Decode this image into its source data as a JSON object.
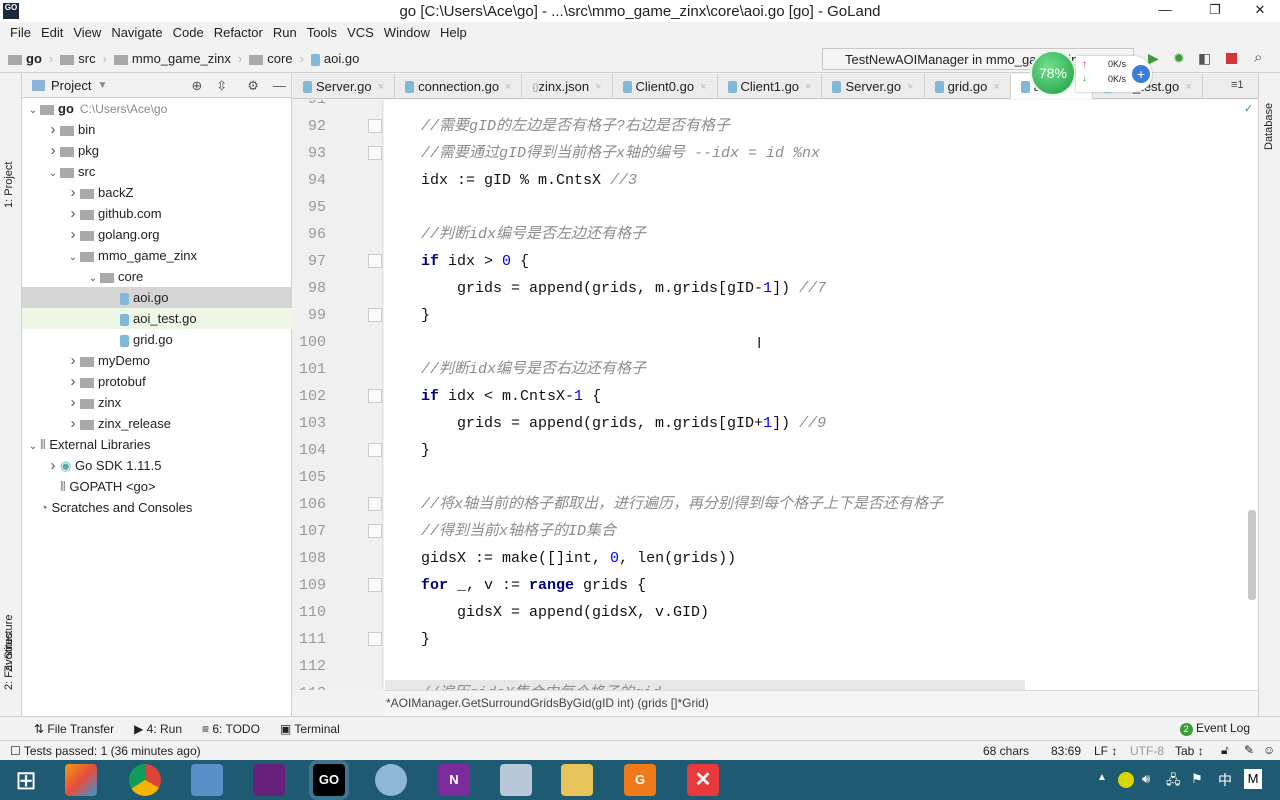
{
  "window": {
    "title": "go [C:\\Users\\Ace\\go] - ...\\src\\mmo_game_zinx\\core\\aoi.go [go] - GoLand",
    "logo": "GO"
  },
  "menu": [
    "File",
    "Edit",
    "View",
    "Navigate",
    "Code",
    "Refactor",
    "Run",
    "Tools",
    "VCS",
    "Window",
    "Help"
  ],
  "breadcrumb": [
    "go",
    "src",
    "mmo_game_zinx",
    "core",
    "aoi.go"
  ],
  "run_config": "TestNewAOIManager in mmo_game_zinx",
  "net_widget": {
    "percent": "78%",
    "up": "0K/s",
    "down": "0K/s"
  },
  "left_strip": {
    "project": "1: Project",
    "structure": "Z: Structure",
    "favorites": "2: Favorites"
  },
  "right_strip": {
    "database": "Database"
  },
  "sidebar": {
    "title": "Project",
    "tree": [
      {
        "label": "go",
        "extra": "C:\\Users\\Ace\\go",
        "depth": 0,
        "arrow": "down",
        "kind": "folder",
        "bold": true
      },
      {
        "label": "bin",
        "depth": 1,
        "arrow": "right",
        "kind": "folder"
      },
      {
        "label": "pkg",
        "depth": 1,
        "arrow": "right",
        "kind": "folder"
      },
      {
        "label": "src",
        "depth": 1,
        "arrow": "down",
        "kind": "folder"
      },
      {
        "label": "backZ",
        "depth": 2,
        "arrow": "right",
        "kind": "folder"
      },
      {
        "label": "github.com",
        "depth": 2,
        "arrow": "right",
        "kind": "folder"
      },
      {
        "label": "golang.org",
        "depth": 2,
        "arrow": "right",
        "kind": "folder"
      },
      {
        "label": "mmo_game_zinx",
        "depth": 2,
        "arrow": "down",
        "kind": "folder"
      },
      {
        "label": "core",
        "depth": 3,
        "arrow": "down",
        "kind": "folder"
      },
      {
        "label": "aoi.go",
        "depth": 4,
        "arrow": "",
        "kind": "go",
        "state": "selected"
      },
      {
        "label": "aoi_test.go",
        "depth": 4,
        "arrow": "",
        "kind": "go",
        "state": "test"
      },
      {
        "label": "grid.go",
        "depth": 4,
        "arrow": "",
        "kind": "go"
      },
      {
        "label": "myDemo",
        "depth": 2,
        "arrow": "right",
        "kind": "folder"
      },
      {
        "label": "protobuf",
        "depth": 2,
        "arrow": "right",
        "kind": "folder"
      },
      {
        "label": "zinx",
        "depth": 2,
        "arrow": "right",
        "kind": "folder"
      },
      {
        "label": "zinx_release",
        "depth": 2,
        "arrow": "right",
        "kind": "folder"
      },
      {
        "label": "External Libraries",
        "depth": 0,
        "arrow": "down",
        "kind": "lib"
      },
      {
        "label": "Go SDK 1.11.5",
        "depth": 1,
        "arrow": "right",
        "kind": "sdk"
      },
      {
        "label": "GOPATH <go>",
        "depth": 1,
        "arrow": "",
        "kind": "lib"
      },
      {
        "label": "Scratches and Consoles",
        "depth": 0,
        "arrow": "",
        "kind": "scratch"
      }
    ]
  },
  "tabs": [
    {
      "label": "Server.go"
    },
    {
      "label": "connection.go"
    },
    {
      "label": "zinx.json"
    },
    {
      "label": "Client0.go"
    },
    {
      "label": "Client1.go"
    },
    {
      "label": "Server.go"
    },
    {
      "label": "grid.go"
    },
    {
      "label": "aoi.go",
      "active": true
    },
    {
      "label": "aoi_test.go"
    }
  ],
  "tabs_overflow": "≡1",
  "code": [
    {
      "n": "91",
      "segs": []
    },
    {
      "n": "92",
      "fold": true,
      "segs": [
        [
          "cm",
          "    //需要gID的左边是否有格子?右边是否有格子"
        ]
      ]
    },
    {
      "n": "93",
      "fold": true,
      "segs": [
        [
          "cm",
          "    //需要通过gID得到当前格子x轴的编号 --idx = id %nx"
        ]
      ]
    },
    {
      "n": "94",
      "segs": [
        [
          "p",
          "    idx := gID % m.CntsX "
        ],
        [
          "cm",
          "//3"
        ]
      ]
    },
    {
      "n": "95",
      "segs": []
    },
    {
      "n": "96",
      "segs": [
        [
          "cm",
          "    //判断idx编号是否左边还有格子"
        ]
      ]
    },
    {
      "n": "97",
      "fold": true,
      "segs": [
        [
          "kw",
          "    if"
        ],
        [
          "p",
          " idx > "
        ],
        [
          "num",
          "0"
        ],
        [
          "p",
          " {"
        ]
      ]
    },
    {
      "n": "98",
      "segs": [
        [
          "p",
          "        grids = append(grids, m.grids[gID-"
        ],
        [
          "num",
          "1"
        ],
        [
          "p",
          "]) "
        ],
        [
          "cm",
          "//7"
        ]
      ]
    },
    {
      "n": "99",
      "fold": true,
      "segs": [
        [
          "p",
          "    }"
        ]
      ]
    },
    {
      "n": "100",
      "segs": []
    },
    {
      "n": "101",
      "segs": [
        [
          "cm",
          "    //判断idx编号是否右边还有格子"
        ]
      ]
    },
    {
      "n": "102",
      "fold": true,
      "segs": [
        [
          "kw",
          "    if"
        ],
        [
          "p",
          " idx < m.CntsX-"
        ],
        [
          "num",
          "1"
        ],
        [
          "p",
          " {"
        ]
      ]
    },
    {
      "n": "103",
      "segs": [
        [
          "p",
          "        grids = append(grids, m.grids[gID+"
        ],
        [
          "num",
          "1"
        ],
        [
          "p",
          "]) "
        ],
        [
          "cm",
          "//9"
        ]
      ]
    },
    {
      "n": "104",
      "fold": true,
      "segs": [
        [
          "p",
          "    }"
        ]
      ]
    },
    {
      "n": "105",
      "segs": []
    },
    {
      "n": "106",
      "fold": true,
      "segs": [
        [
          "cm",
          "    //将x轴当前的格子都取出，进行遍历，再分别得到每个格子上下是否还有格子"
        ]
      ]
    },
    {
      "n": "107",
      "fold": true,
      "segs": [
        [
          "cm",
          "    //得到当前x轴格子的ID集合"
        ]
      ]
    },
    {
      "n": "108",
      "segs": [
        [
          "p",
          "    gidsX := make([]int, "
        ],
        [
          "num",
          "0"
        ],
        [
          "p",
          ", len(grids))"
        ]
      ]
    },
    {
      "n": "109",
      "fold": true,
      "segs": [
        [
          "kw",
          "    for"
        ],
        [
          "p",
          " _, v := "
        ],
        [
          "kw",
          "range"
        ],
        [
          "p",
          " grids {"
        ]
      ]
    },
    {
      "n": "110",
      "segs": [
        [
          "p",
          "        gidsX = append(gidsX, v.GID)"
        ]
      ]
    },
    {
      "n": "111",
      "fold": true,
      "segs": [
        [
          "p",
          "    }"
        ]
      ]
    },
    {
      "n": "112",
      "segs": []
    },
    {
      "n": "113",
      "segs": [
        [
          "cm",
          "    //遍历gidsX集合中每个格子的gid"
        ]
      ]
    }
  ],
  "hint": "*AOIManager.GetSurroundGridsByGid(gID int) (grids []*Grid)",
  "toolwindows": {
    "file_transfer": "File Transfer",
    "run": "4: Run",
    "todo": "6: TODO",
    "terminal": "Terminal",
    "event_log": "Event Log",
    "event_count": "2"
  },
  "status": {
    "message": "Tests passed: 1 (36 minutes ago)",
    "chars": "68 chars",
    "position": "83:69",
    "line_sep": "LF",
    "encoding": "UTF-8",
    "indent": "Tab"
  },
  "taskbar": {
    "ime": "中",
    "ime_mode": "M"
  }
}
